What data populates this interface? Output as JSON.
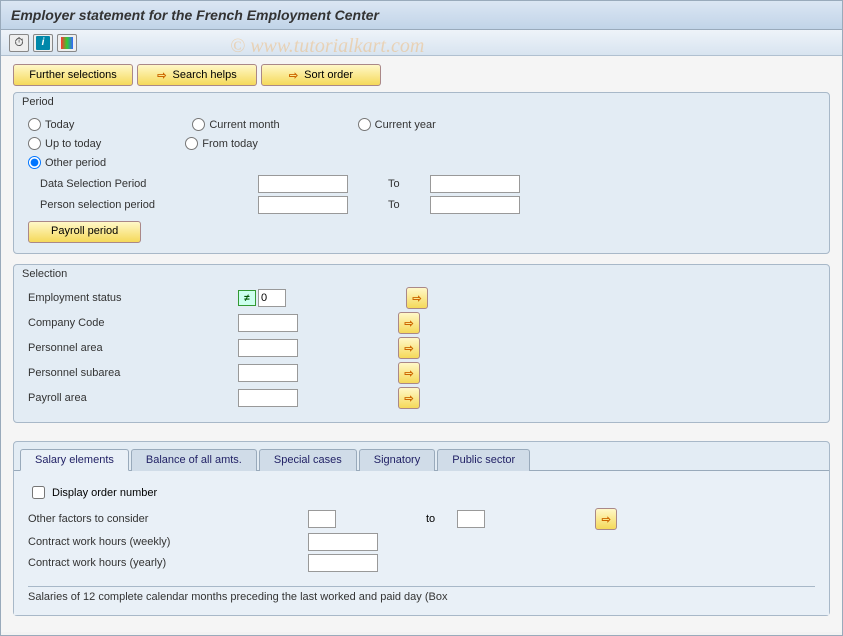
{
  "title": "Employer statement for the French Employment Center",
  "watermark": "© www.tutorialkart.com",
  "toolbar": {
    "further_selections": "Further selections",
    "search_helps": "Search helps",
    "sort_order": "Sort order"
  },
  "period": {
    "title": "Period",
    "today": "Today",
    "current_month": "Current month",
    "current_year": "Current year",
    "up_to_today": "Up to today",
    "from_today": "From today",
    "other_period": "Other period",
    "data_sel": "Data Selection Period",
    "person_sel": "Person selection period",
    "to": "To",
    "payroll_btn": "Payroll period"
  },
  "selection": {
    "title": "Selection",
    "emp_status": "Employment status",
    "emp_status_val": "0",
    "company_code": "Company Code",
    "pers_area": "Personnel area",
    "pers_subarea": "Personnel subarea",
    "payroll_area": "Payroll area"
  },
  "tabs": {
    "t1": "Salary elements",
    "t2": "Balance of all amts.",
    "t3": "Special cases",
    "t4": "Signatory",
    "t5": "Public sector"
  },
  "salary": {
    "display_order": "Display order number",
    "other_factors": "Other factors to consider",
    "to": "to",
    "contract_weekly": "Contract work hours (weekly)",
    "contract_yearly": "Contract work hours (yearly)",
    "box_note": "Salaries of 12 complete calendar months preceding the last worked and paid day (Box"
  }
}
